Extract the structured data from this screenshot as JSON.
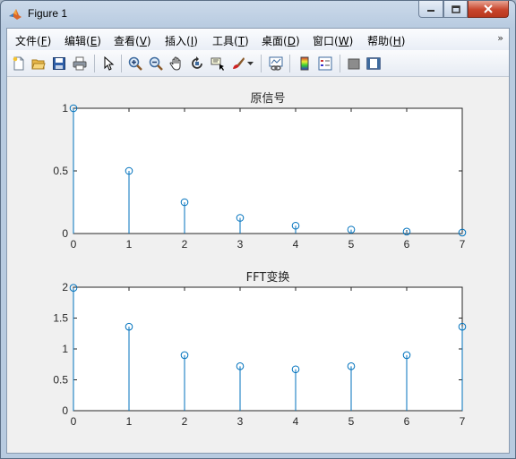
{
  "window": {
    "title": "Figure 1"
  },
  "menu": {
    "items": [
      {
        "label": "文件(",
        "key": "F",
        "suffix": ")"
      },
      {
        "label": "编辑(",
        "key": "E",
        "suffix": ")"
      },
      {
        "label": "查看(",
        "key": "V",
        "suffix": ")"
      },
      {
        "label": "插入(",
        "key": "I",
        "suffix": ")"
      },
      {
        "label": "工具(",
        "key": "T",
        "suffix": ")"
      },
      {
        "label": "桌面(",
        "key": "D",
        "suffix": ")"
      },
      {
        "label": "窗口(",
        "key": "W",
        "suffix": ")"
      },
      {
        "label": "帮助(",
        "key": "H",
        "suffix": ")"
      }
    ],
    "overflow_icon": "chevron-double-icon"
  },
  "toolbar": {
    "icons": [
      "new-figure-icon",
      "open-file-icon",
      "save-icon",
      "print-icon",
      "pointer-icon",
      "zoom-in-icon",
      "zoom-out-icon",
      "pan-icon",
      "rotate-icon",
      "data-cursor-icon",
      "brush-icon",
      "brush-dropdown-icon",
      "link-plot-icon",
      "colorbar-icon",
      "legend-icon",
      "hide-plot-tools-icon",
      "show-plot-tools-icon"
    ]
  },
  "colors": {
    "stem": "#0072bd",
    "axis": "#262626",
    "axes_bg": "#ffffff",
    "figure_bg": "#f0f0f0"
  },
  "chart_data": [
    {
      "type": "stem",
      "title": "原信号",
      "x": [
        0,
        1,
        2,
        3,
        4,
        5,
        6,
        7
      ],
      "values": [
        1,
        0.5,
        0.25,
        0.125,
        0.0625,
        0.03125,
        0.015625,
        0.0078125
      ],
      "xlim": [
        0,
        7
      ],
      "ylim": [
        0,
        1
      ],
      "xticks": [
        "0",
        "1",
        "2",
        "3",
        "4",
        "5",
        "6",
        "7"
      ],
      "yticks": [
        "0",
        "0.5",
        "1"
      ],
      "ytick_values": [
        0,
        0.5,
        1
      ],
      "grid": false
    },
    {
      "type": "stem",
      "title": "FFT变换",
      "x": [
        0,
        1,
        2,
        3,
        4,
        5,
        6,
        7
      ],
      "values": [
        1.99,
        1.36,
        0.9,
        0.72,
        0.67,
        0.72,
        0.9,
        1.36
      ],
      "xlim": [
        0,
        7
      ],
      "ylim": [
        0,
        2
      ],
      "xticks": [
        "0",
        "1",
        "2",
        "3",
        "4",
        "5",
        "6",
        "7"
      ],
      "yticks": [
        "0",
        "0.5",
        "1",
        "1.5",
        "2"
      ],
      "ytick_values": [
        0,
        0.5,
        1,
        1.5,
        2
      ],
      "grid": false
    }
  ]
}
